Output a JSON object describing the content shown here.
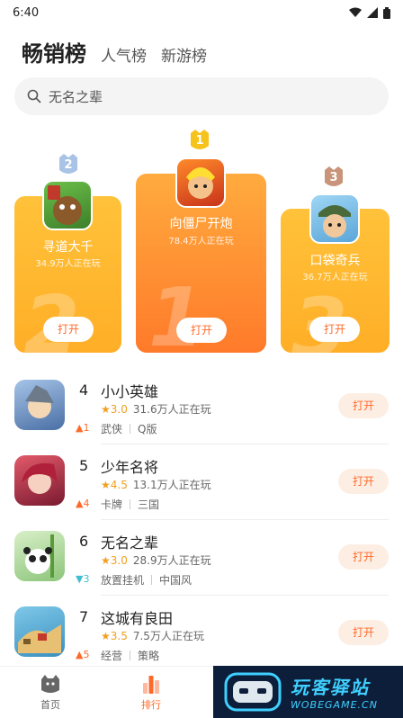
{
  "status_bar": {
    "time": "6:40"
  },
  "tabs": [
    {
      "label": "畅销榜",
      "active": true
    },
    {
      "label": "人气榜",
      "active": false
    },
    {
      "label": "新游榜",
      "active": false
    }
  ],
  "search": {
    "placeholder": "无名之辈"
  },
  "podium": [
    {
      "rank": "2",
      "name": "寻道大千",
      "players": "34.9万人正在玩",
      "button": "打开"
    },
    {
      "rank": "1",
      "name": "向僵尸开炮",
      "players": "78.4万人正在玩",
      "button": "打开"
    },
    {
      "rank": "3",
      "name": "口袋奇兵",
      "players": "36.7万人正在玩",
      "button": "打开"
    }
  ],
  "list": [
    {
      "rank": "4",
      "trend": "1",
      "trend_dir": "up",
      "name": "小小英雄",
      "score": "3.0",
      "players": "31.6万人正在玩",
      "tags": [
        "武侠",
        "Q版"
      ],
      "button": "打开"
    },
    {
      "rank": "5",
      "trend": "4",
      "trend_dir": "up",
      "name": "少年名将",
      "score": "4.5",
      "players": "13.1万人正在玩",
      "tags": [
        "卡牌",
        "三国"
      ],
      "button": "打开"
    },
    {
      "rank": "6",
      "trend": "3",
      "trend_dir": "down",
      "name": "无名之辈",
      "score": "3.0",
      "players": "28.9万人正在玩",
      "tags": [
        "放置挂机",
        "中国风"
      ],
      "button": "打开"
    },
    {
      "rank": "7",
      "trend": "5",
      "trend_dir": "up",
      "name": "这城有良田",
      "score": "3.5",
      "players": "7.5万人正在玩",
      "tags": [
        "经营",
        "策略"
      ],
      "button": "打开"
    }
  ],
  "bottom_nav": [
    {
      "label": "首页",
      "icon": "home-icon",
      "active": false
    },
    {
      "label": "排行",
      "icon": "rank-icon",
      "active": true
    }
  ],
  "watermark": {
    "text": "玩客驿站",
    "url": "WOBEGAME.CN"
  },
  "colors": {
    "accent": "#ff6a2a",
    "gold": "#ffae27",
    "star": "#f0a020",
    "trend_up": "#ff6a2a",
    "trend_down": "#3fbfd0"
  }
}
